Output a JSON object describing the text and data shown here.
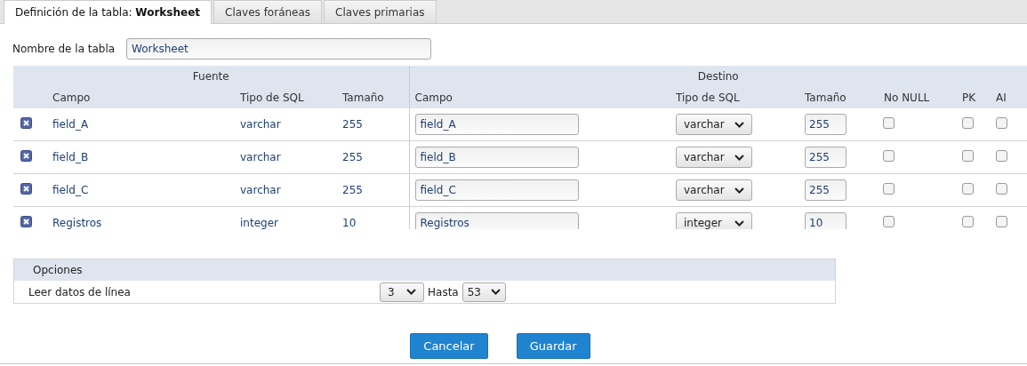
{
  "tabs": [
    {
      "label": "Definición de la tabla: **Worksheet**",
      "selected": true
    },
    {
      "label": "Claves foráneas",
      "selected": false
    },
    {
      "label": "Claves primarias",
      "selected": false
    }
  ],
  "table_name": {
    "label": "Nombre de la tabla",
    "value": "Worksheet"
  },
  "mapping": {
    "source_title": "Fuente",
    "target_title": "Destino",
    "columns": [
      "Campo",
      "Tipo de SQL",
      "Tamaño",
      "Campo",
      "Tipo de SQL",
      "Tamaño",
      "No NULL",
      "PK",
      "AI"
    ],
    "rows": [
      {
        "source_field": "field_A",
        "source_type": "varchar",
        "source_size": "255",
        "target_field": "field_A",
        "target_type": "varchar",
        "target_size": "255",
        "not_null": false,
        "pk": false,
        "ai": false
      },
      {
        "source_field": "field_B",
        "source_type": "varchar",
        "source_size": "255",
        "target_field": "field_B",
        "target_type": "varchar",
        "target_size": "255",
        "not_null": false,
        "pk": false,
        "ai": false
      },
      {
        "source_field": "field_C",
        "source_type": "varchar",
        "source_size": "255",
        "target_field": "field_C",
        "target_type": "varchar",
        "target_size": "255",
        "not_null": false,
        "pk": false,
        "ai": false
      },
      {
        "source_field": "Registros",
        "source_type": "integer",
        "source_size": "10",
        "target_field": "Registros",
        "target_type": "integer",
        "target_size": "10",
        "not_null": false,
        "pk": false,
        "ai": false
      }
    ]
  },
  "options": {
    "title": "Opciones",
    "label": "Leer datos de línea",
    "from": "3",
    "to_label": "Hasta",
    "to": "53"
  },
  "buttons": [
    "Cancelar",
    "Guardar"
  ]
}
